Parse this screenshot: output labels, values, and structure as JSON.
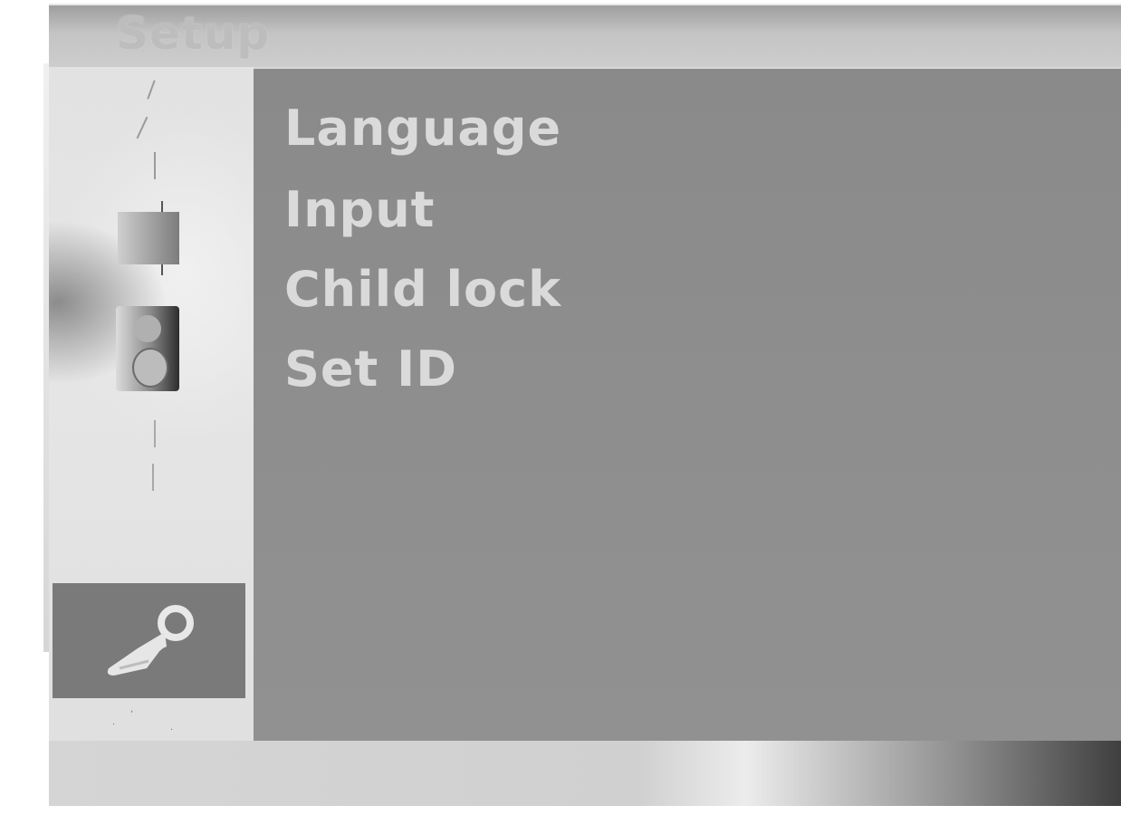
{
  "title_bar": {
    "title": "Setup"
  },
  "sidebar": {
    "items": [
      {
        "name": "station-icon",
        "selected": false
      },
      {
        "name": "picture-icon",
        "selected": false
      },
      {
        "name": "sound-icon",
        "selected": false
      },
      {
        "name": "time-icon",
        "selected": false
      },
      {
        "name": "setup-wrench-icon",
        "selected": true
      },
      {
        "name": "special-icon",
        "selected": false
      }
    ]
  },
  "menu": {
    "items": [
      {
        "label": "Language"
      },
      {
        "label": "Input"
      },
      {
        "label": "Child lock"
      },
      {
        "label": "Set ID"
      }
    ]
  },
  "colors": {
    "panel": "#8c8c8c",
    "menu_text": "#dadada",
    "selected_tile": "#7a7a7a",
    "title_text": "#bdbdbd"
  }
}
